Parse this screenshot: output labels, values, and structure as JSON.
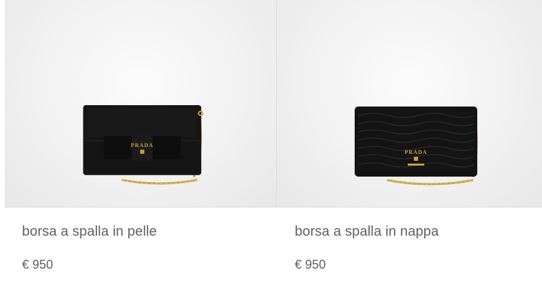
{
  "products": [
    {
      "title": "borsa a spalla in pelle",
      "price": "€ 950",
      "brand_logo": "PRADA"
    },
    {
      "title": "borsa a spalla in nappa",
      "price": "€ 950",
      "brand_logo": "PRADA"
    }
  ],
  "colors": {
    "text": "#5f5f5f",
    "image_background": "#f1f1f1",
    "divider": "#dcdcdc",
    "bag": "#151515",
    "gold": "#c9a13b"
  }
}
